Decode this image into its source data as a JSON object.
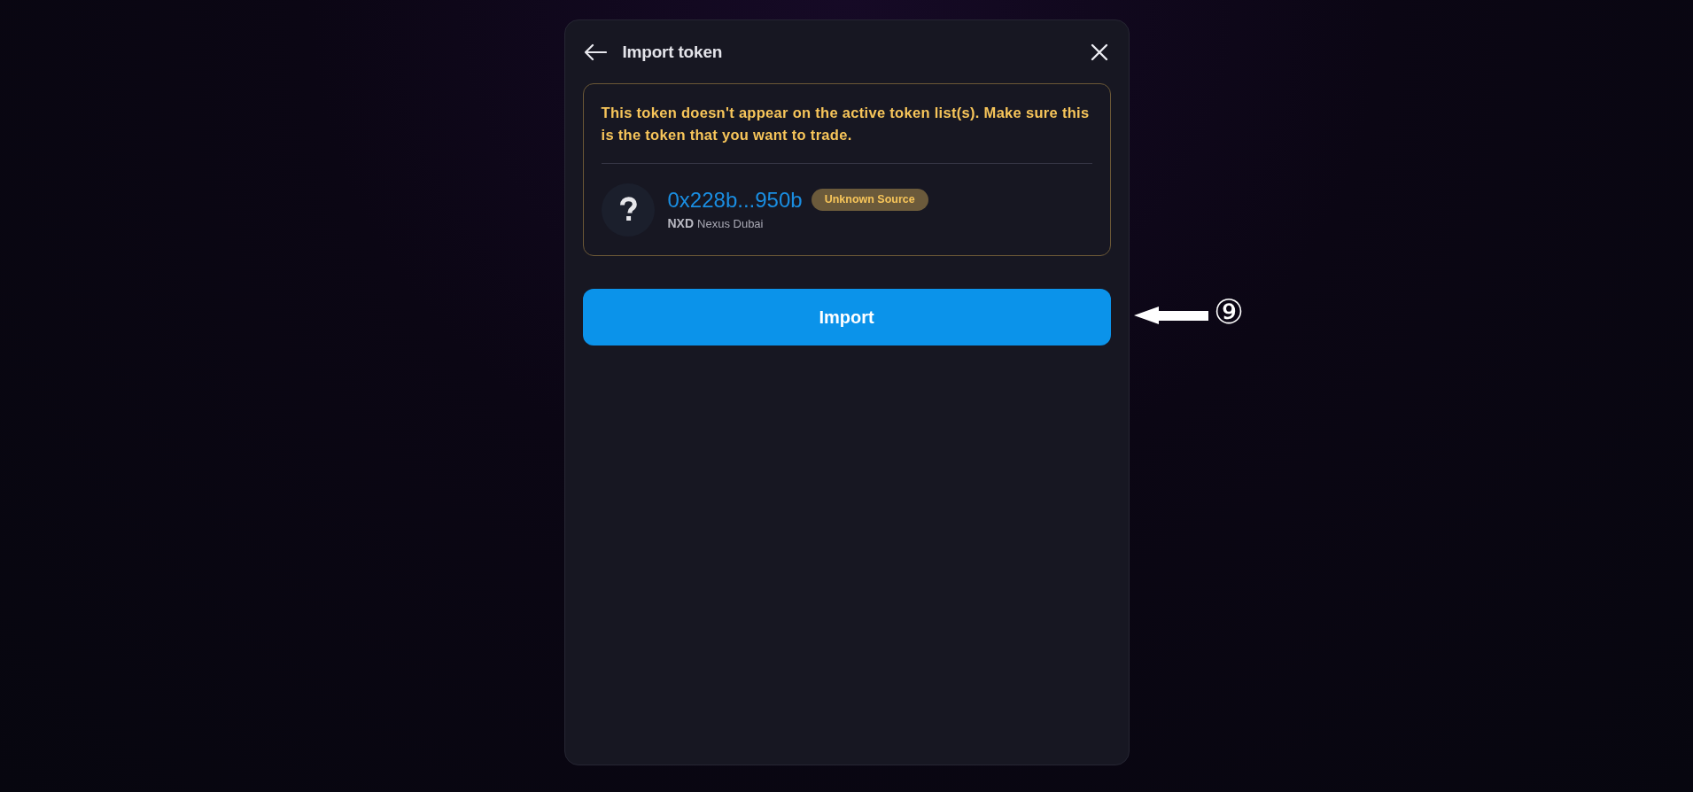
{
  "dialog": {
    "title": "Import token",
    "warning": {
      "message": "This token doesn't appear on the active token list(s). Make sure this is the token that you want to trade.",
      "token": {
        "address": "0x228b...950b",
        "badge": "Unknown Source",
        "symbol": "NXD",
        "name": "Nexus Dubai"
      }
    },
    "import_button": {
      "label": "Import"
    }
  },
  "annotation": {
    "label": "⑨"
  }
}
